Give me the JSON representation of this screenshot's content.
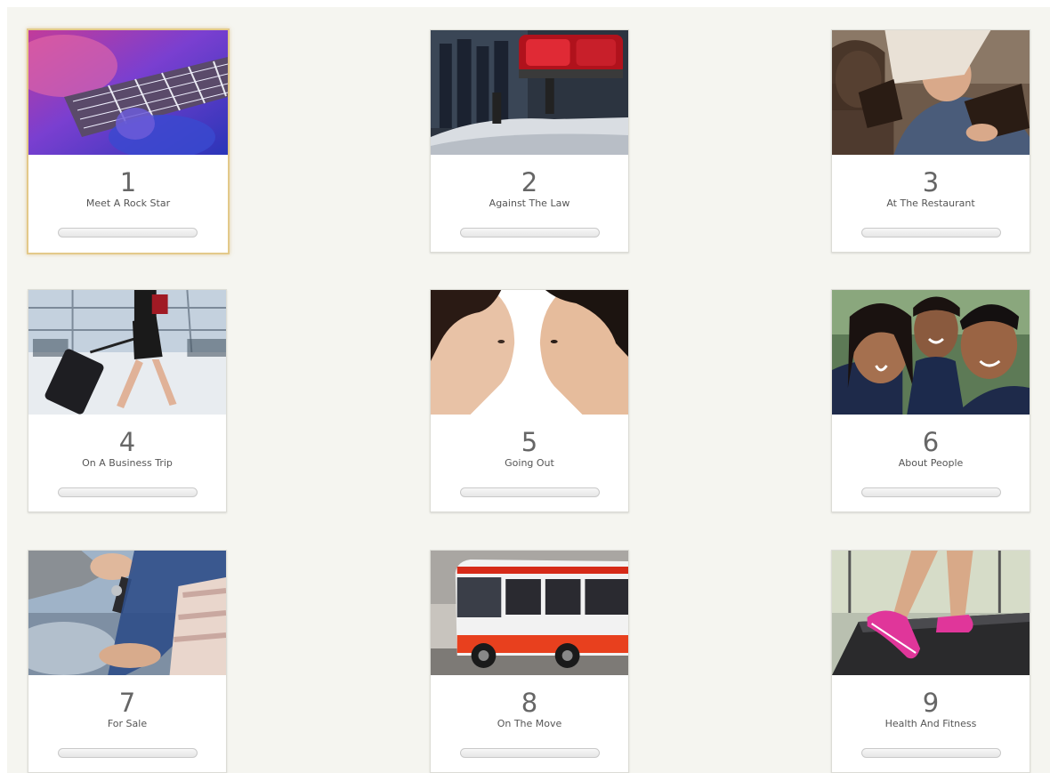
{
  "lessons": [
    {
      "number": "1",
      "title": "Meet A Rock Star",
      "progress": 0,
      "selected": true,
      "image": "guitar-photo"
    },
    {
      "number": "2",
      "title": "Against The Law",
      "progress": 0,
      "selected": false,
      "image": "police-car-photo"
    },
    {
      "number": "3",
      "title": "At The Restaurant",
      "progress": 0,
      "selected": false,
      "image": "restaurant-photo"
    },
    {
      "number": "4",
      "title": "On A Business Trip",
      "progress": 0,
      "selected": false,
      "image": "airport-suitcase-photo"
    },
    {
      "number": "5",
      "title": "Going Out",
      "progress": 0,
      "selected": false,
      "image": "couple-photo"
    },
    {
      "number": "6",
      "title": "About People",
      "progress": 0,
      "selected": false,
      "image": "family-photo"
    },
    {
      "number": "7",
      "title": "For Sale",
      "progress": 0,
      "selected": false,
      "image": "car-keys-photo"
    },
    {
      "number": "8",
      "title": "On The Move",
      "progress": 0,
      "selected": false,
      "image": "bus-photo"
    },
    {
      "number": "9",
      "title": "Health And Fitness",
      "progress": 0,
      "selected": false,
      "image": "treadmill-photo"
    }
  ],
  "colors": {
    "background": "#f5f5f0",
    "card": "#ffffff",
    "selected_border": "#e3c98a",
    "number_text": "#666666",
    "title_text": "#555555"
  }
}
